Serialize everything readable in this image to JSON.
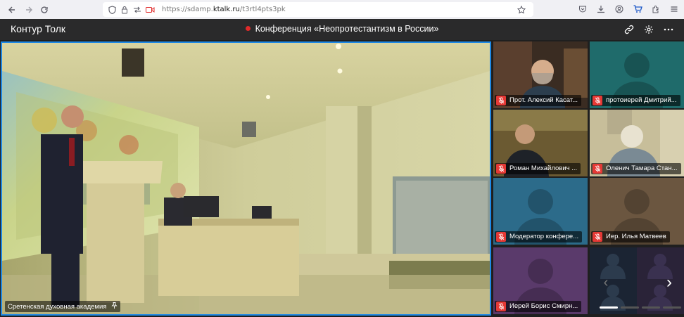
{
  "browser": {
    "url_scheme": "https://sdamp.",
    "url_host": "ktalk.ru",
    "url_path": "/t3rtl4pts3pk"
  },
  "app": {
    "title": "Контур Толк",
    "conference_title": "Конференция «Неопротестантизм в России»",
    "accent_color": "#1e88e5",
    "recording_color": "#e02a2a"
  },
  "main_video": {
    "label": "Сретенская духовная академия"
  },
  "participants": [
    {
      "name": "Прот. Алексий Касат...",
      "kind": "video",
      "bg": "#4a3a2a"
    },
    {
      "name": "протоиерей Дмитрий...",
      "kind": "avatar",
      "bg": "#1f6b6b"
    },
    {
      "name": "Роман Михайлович ...",
      "kind": "video",
      "bg": "#6b5a32"
    },
    {
      "name": "Оленич Тамара Стан...",
      "kind": "video",
      "bg": "#cfc6a8"
    },
    {
      "name": "Модератор конфере...",
      "kind": "avatar",
      "bg": "#2c6b8a"
    },
    {
      "name": "Иер. Илья Матвеев",
      "kind": "avatar",
      "bg": "#6b5640"
    },
    {
      "name": "Иерей Борис Смирн...",
      "kind": "avatar",
      "bg": "#5a3a6b"
    },
    {
      "name": "",
      "kind": "multi",
      "bg": "#243040"
    }
  ],
  "pager": {
    "pages": 4,
    "current": 1
  }
}
